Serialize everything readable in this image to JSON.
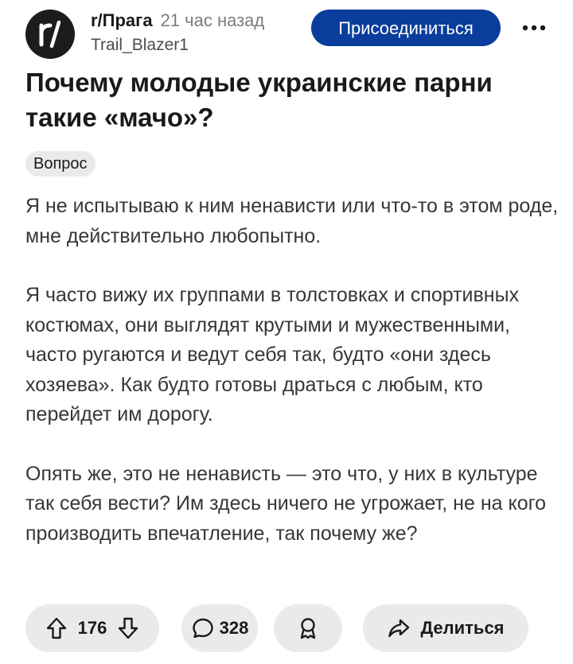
{
  "post": {
    "subreddit": "r/Прага",
    "time_ago": "21 час назад",
    "author": "Trail_Blazer1",
    "join_label": "Присоединиться",
    "title": "Почему молодые украинские парни такие «мачо»?",
    "flair": "Вопрос",
    "paragraphs": [
      "Я не испытываю к ним ненависти или что-то в этом роде, мне действительно любопытно.",
      "Я часто вижу их группами в толстовках и спортивных костюмах, они выглядят крутыми и мужественными, часто ругаются и ведут себя так, будто «они здесь хозяева». Как будто готовы драться с любым, кто перейдет им дорогу.",
      "Опять же, это не ненависть — это что, у них в культуре так себя вести? Им здесь ничего не угрожает, не на кого производить впечатление, так почему же?"
    ]
  },
  "actions": {
    "votes": "176",
    "comments": "328",
    "share_label": "Делиться"
  },
  "icons": {
    "avatar": "subreddit-logo-icon",
    "more": "more-options-icon",
    "upvote": "upvote-arrow-icon",
    "downvote": "downvote-arrow-icon",
    "comment": "comment-bubble-icon",
    "award": "award-icon",
    "share": "share-arrow-icon"
  },
  "colors": {
    "join_button": "#0a3d9c",
    "pill_background": "#e8eaec",
    "avatar_background": "#1b1c1c"
  }
}
